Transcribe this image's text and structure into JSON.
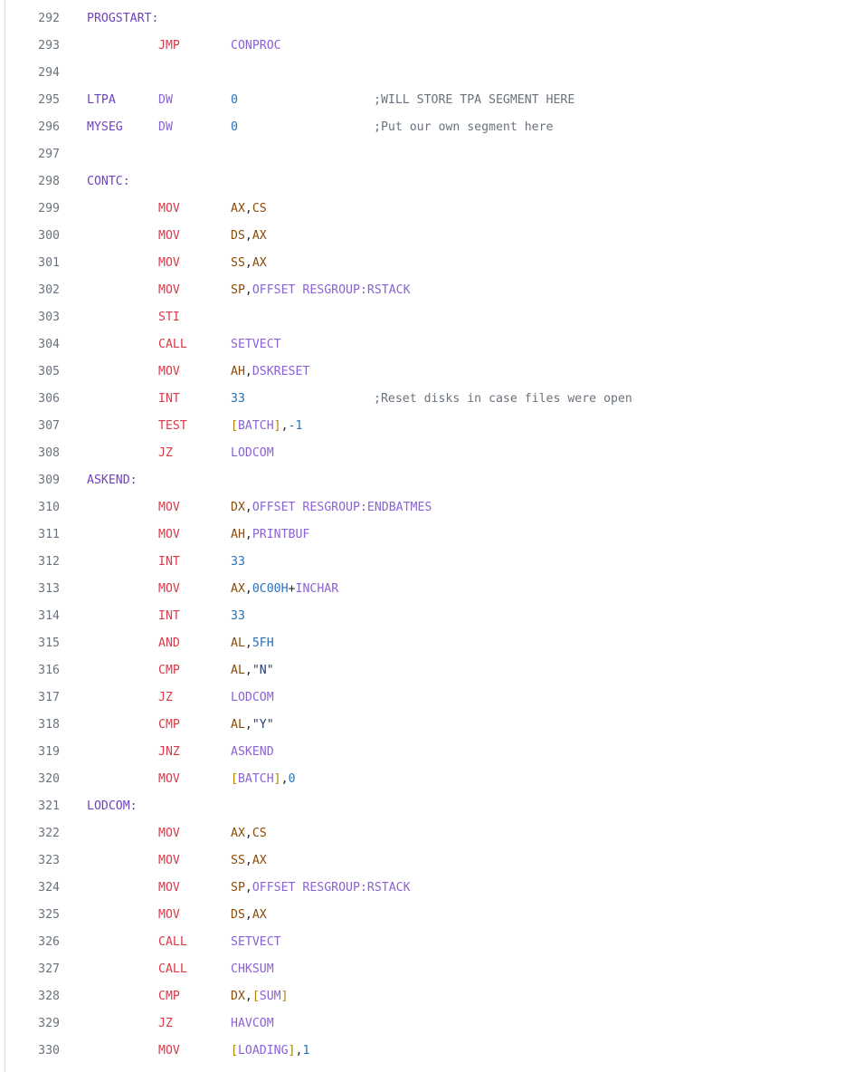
{
  "colors": {
    "line_number": "#6a737d",
    "label": "#6f42c1",
    "mnemonic": "#d73a49",
    "register": "#8a4b08",
    "identifier": "#8a63d2",
    "number": "#2c6fb7",
    "string": "#1f3f77",
    "bracket": "#b08000",
    "comment": "#6a737d"
  },
  "lines": [
    {
      "n": "292",
      "label": "PROGSTART:",
      "mn": "",
      "dir": false,
      "ops": [],
      "comment": ""
    },
    {
      "n": "293",
      "label": "",
      "mn": "JMP",
      "dir": false,
      "ops": [
        {
          "t": "id",
          "v": "CONPROC"
        }
      ],
      "comment": ""
    },
    {
      "n": "294",
      "label": "",
      "mn": "",
      "dir": false,
      "ops": [],
      "comment": ""
    },
    {
      "n": "295",
      "label": "LTPA",
      "mn": "DW",
      "dir": true,
      "ops": [
        {
          "t": "num",
          "v": "0"
        }
      ],
      "comment": ";WILL STORE TPA SEGMENT HERE"
    },
    {
      "n": "296",
      "label": "MYSEG",
      "mn": "DW",
      "dir": true,
      "ops": [
        {
          "t": "num",
          "v": "0"
        }
      ],
      "comment": ";Put our own segment here"
    },
    {
      "n": "297",
      "label": "",
      "mn": "",
      "dir": false,
      "ops": [],
      "comment": ""
    },
    {
      "n": "298",
      "label": "CONTC:",
      "mn": "",
      "dir": false,
      "ops": [],
      "comment": ""
    },
    {
      "n": "299",
      "label": "",
      "mn": "MOV",
      "dir": false,
      "ops": [
        {
          "t": "reg",
          "v": "AX"
        },
        {
          "t": "p",
          "v": ","
        },
        {
          "t": "reg",
          "v": "CS"
        }
      ],
      "comment": ""
    },
    {
      "n": "300",
      "label": "",
      "mn": "MOV",
      "dir": false,
      "ops": [
        {
          "t": "reg",
          "v": "DS"
        },
        {
          "t": "p",
          "v": ","
        },
        {
          "t": "reg",
          "v": "AX"
        }
      ],
      "comment": ""
    },
    {
      "n": "301",
      "label": "",
      "mn": "MOV",
      "dir": false,
      "ops": [
        {
          "t": "reg",
          "v": "SS"
        },
        {
          "t": "p",
          "v": ","
        },
        {
          "t": "reg",
          "v": "AX"
        }
      ],
      "comment": ""
    },
    {
      "n": "302",
      "label": "",
      "mn": "MOV",
      "dir": false,
      "ops": [
        {
          "t": "reg",
          "v": "SP"
        },
        {
          "t": "p",
          "v": ","
        },
        {
          "t": "id",
          "v": "OFFSET RESGROUP:RSTACK"
        }
      ],
      "comment": ""
    },
    {
      "n": "303",
      "label": "",
      "mn": "STI",
      "dir": false,
      "ops": [],
      "comment": ""
    },
    {
      "n": "304",
      "label": "",
      "mn": "CALL",
      "dir": false,
      "ops": [
        {
          "t": "id",
          "v": "SETVECT"
        }
      ],
      "comment": ""
    },
    {
      "n": "305",
      "label": "",
      "mn": "MOV",
      "dir": false,
      "ops": [
        {
          "t": "reg",
          "v": "AH"
        },
        {
          "t": "p",
          "v": ","
        },
        {
          "t": "id",
          "v": "DSKRESET"
        }
      ],
      "comment": ""
    },
    {
      "n": "306",
      "label": "",
      "mn": "INT",
      "dir": false,
      "ops": [
        {
          "t": "num",
          "v": "33"
        }
      ],
      "comment": ";Reset disks in case files were open"
    },
    {
      "n": "307",
      "label": "",
      "mn": "TEST",
      "dir": false,
      "ops": [
        {
          "t": "br",
          "v": "["
        },
        {
          "t": "id",
          "v": "BATCH"
        },
        {
          "t": "br",
          "v": "]"
        },
        {
          "t": "p",
          "v": ","
        },
        {
          "t": "num",
          "v": "-1"
        }
      ],
      "comment": ""
    },
    {
      "n": "308",
      "label": "",
      "mn": "JZ",
      "dir": false,
      "ops": [
        {
          "t": "id",
          "v": "LODCOM"
        }
      ],
      "comment": ""
    },
    {
      "n": "309",
      "label": "ASKEND:",
      "mn": "",
      "dir": false,
      "ops": [],
      "comment": ""
    },
    {
      "n": "310",
      "label": "",
      "mn": "MOV",
      "dir": false,
      "ops": [
        {
          "t": "reg",
          "v": "DX"
        },
        {
          "t": "p",
          "v": ","
        },
        {
          "t": "id",
          "v": "OFFSET RESGROUP:ENDBATMES"
        }
      ],
      "comment": ""
    },
    {
      "n": "311",
      "label": "",
      "mn": "MOV",
      "dir": false,
      "ops": [
        {
          "t": "reg",
          "v": "AH"
        },
        {
          "t": "p",
          "v": ","
        },
        {
          "t": "id",
          "v": "PRINTBUF"
        }
      ],
      "comment": ""
    },
    {
      "n": "312",
      "label": "",
      "mn": "INT",
      "dir": false,
      "ops": [
        {
          "t": "num",
          "v": "33"
        }
      ],
      "comment": ""
    },
    {
      "n": "313",
      "label": "",
      "mn": "MOV",
      "dir": false,
      "ops": [
        {
          "t": "reg",
          "v": "AX"
        },
        {
          "t": "p",
          "v": ","
        },
        {
          "t": "num",
          "v": "0C00H"
        },
        {
          "t": "p",
          "v": "+"
        },
        {
          "t": "id",
          "v": "INCHAR"
        }
      ],
      "comment": ""
    },
    {
      "n": "314",
      "label": "",
      "mn": "INT",
      "dir": false,
      "ops": [
        {
          "t": "num",
          "v": "33"
        }
      ],
      "comment": ""
    },
    {
      "n": "315",
      "label": "",
      "mn": "AND",
      "dir": false,
      "ops": [
        {
          "t": "reg",
          "v": "AL"
        },
        {
          "t": "p",
          "v": ","
        },
        {
          "t": "num",
          "v": "5FH"
        }
      ],
      "comment": ""
    },
    {
      "n": "316",
      "label": "",
      "mn": "CMP",
      "dir": false,
      "ops": [
        {
          "t": "reg",
          "v": "AL"
        },
        {
          "t": "p",
          "v": ","
        },
        {
          "t": "str",
          "v": "\"N\""
        }
      ],
      "comment": ""
    },
    {
      "n": "317",
      "label": "",
      "mn": "JZ",
      "dir": false,
      "ops": [
        {
          "t": "id",
          "v": "LODCOM"
        }
      ],
      "comment": ""
    },
    {
      "n": "318",
      "label": "",
      "mn": "CMP",
      "dir": false,
      "ops": [
        {
          "t": "reg",
          "v": "AL"
        },
        {
          "t": "p",
          "v": ","
        },
        {
          "t": "str",
          "v": "\"Y\""
        }
      ],
      "comment": ""
    },
    {
      "n": "319",
      "label": "",
      "mn": "JNZ",
      "dir": false,
      "ops": [
        {
          "t": "id",
          "v": "ASKEND"
        }
      ],
      "comment": ""
    },
    {
      "n": "320",
      "label": "",
      "mn": "MOV",
      "dir": false,
      "ops": [
        {
          "t": "br",
          "v": "["
        },
        {
          "t": "id",
          "v": "BATCH"
        },
        {
          "t": "br",
          "v": "]"
        },
        {
          "t": "p",
          "v": ","
        },
        {
          "t": "num",
          "v": "0"
        }
      ],
      "comment": ""
    },
    {
      "n": "321",
      "label": "LODCOM:",
      "mn": "",
      "dir": false,
      "ops": [],
      "comment": ""
    },
    {
      "n": "322",
      "label": "",
      "mn": "MOV",
      "dir": false,
      "ops": [
        {
          "t": "reg",
          "v": "AX"
        },
        {
          "t": "p",
          "v": ","
        },
        {
          "t": "reg",
          "v": "CS"
        }
      ],
      "comment": ""
    },
    {
      "n": "323",
      "label": "",
      "mn": "MOV",
      "dir": false,
      "ops": [
        {
          "t": "reg",
          "v": "SS"
        },
        {
          "t": "p",
          "v": ","
        },
        {
          "t": "reg",
          "v": "AX"
        }
      ],
      "comment": ""
    },
    {
      "n": "324",
      "label": "",
      "mn": "MOV",
      "dir": false,
      "ops": [
        {
          "t": "reg",
          "v": "SP"
        },
        {
          "t": "p",
          "v": ","
        },
        {
          "t": "id",
          "v": "OFFSET RESGROUP:RSTACK"
        }
      ],
      "comment": ""
    },
    {
      "n": "325",
      "label": "",
      "mn": "MOV",
      "dir": false,
      "ops": [
        {
          "t": "reg",
          "v": "DS"
        },
        {
          "t": "p",
          "v": ","
        },
        {
          "t": "reg",
          "v": "AX"
        }
      ],
      "comment": ""
    },
    {
      "n": "326",
      "label": "",
      "mn": "CALL",
      "dir": false,
      "ops": [
        {
          "t": "id",
          "v": "SETVECT"
        }
      ],
      "comment": ""
    },
    {
      "n": "327",
      "label": "",
      "mn": "CALL",
      "dir": false,
      "ops": [
        {
          "t": "id",
          "v": "CHKSUM"
        }
      ],
      "comment": ""
    },
    {
      "n": "328",
      "label": "",
      "mn": "CMP",
      "dir": false,
      "ops": [
        {
          "t": "reg",
          "v": "DX"
        },
        {
          "t": "p",
          "v": ","
        },
        {
          "t": "br",
          "v": "["
        },
        {
          "t": "id",
          "v": "SUM"
        },
        {
          "t": "br",
          "v": "]"
        }
      ],
      "comment": ""
    },
    {
      "n": "329",
      "label": "",
      "mn": "JZ",
      "dir": false,
      "ops": [
        {
          "t": "id",
          "v": "HAVCOM"
        }
      ],
      "comment": ""
    },
    {
      "n": "330",
      "label": "",
      "mn": "MOV",
      "dir": false,
      "ops": [
        {
          "t": "br",
          "v": "["
        },
        {
          "t": "id",
          "v": "LOADING"
        },
        {
          "t": "br",
          "v": "]"
        },
        {
          "t": "p",
          "v": ","
        },
        {
          "t": "num",
          "v": "1"
        }
      ],
      "comment": ""
    }
  ]
}
